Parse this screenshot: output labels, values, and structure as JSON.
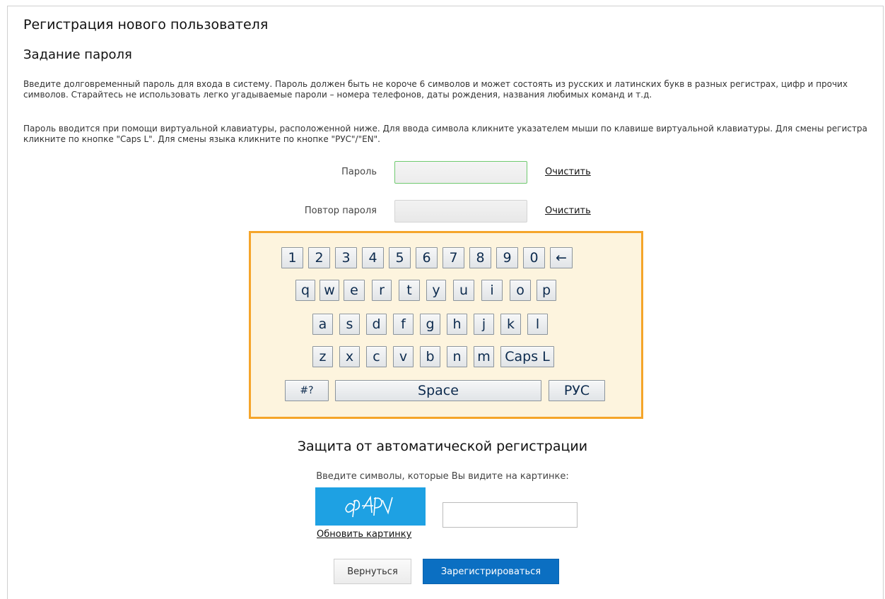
{
  "page": {
    "title": "Регистрация нового пользователя",
    "section_title": "Задание пароля",
    "paragraph1": "Введите долговременный пароль для входа в систему. Пароль должен быть не короче 6 символов и может состоять из русских и латинских букв в разных регистрах, цифр и прочих символов. Старайтесь не использовать легко угадываемые пароли – номера телефонов, даты рождения, названия любимых команд и т.д.",
    "paragraph2": "Пароль вводится при помощи виртуальной клавиатуры, расположенной ниже. Для ввода символа кликните указателем мыши по клавише виртуальной клавиатуры. Для смены регистра кликните по кнопке \"Caps L\". Для смены языка кликните по кнопке \"РУС\"/\"EN\"."
  },
  "password": {
    "label": "Пароль",
    "value": "",
    "clear_label": "Очистить"
  },
  "password_repeat": {
    "label": "Повтор пароля",
    "value": "",
    "clear_label": "Очистить"
  },
  "keyboard": {
    "row1": [
      "1",
      "2",
      "3",
      "4",
      "5",
      "6",
      "7",
      "8",
      "9",
      "0",
      "←"
    ],
    "row2": [
      "q",
      "w",
      "e",
      "r",
      "t",
      "y",
      "u",
      "i",
      "o",
      "p"
    ],
    "row3": [
      "a",
      "s",
      "d",
      "f",
      "g",
      "h",
      "j",
      "k",
      "l"
    ],
    "row4": [
      "z",
      "x",
      "c",
      "v",
      "b",
      "n",
      "m",
      "Caps L"
    ],
    "row5": [
      "#?",
      "Space",
      "РУС"
    ],
    "border_color": "#f5a52a",
    "background_color": "#fdf4de"
  },
  "captcha": {
    "title": "Защита от автоматической регистрации",
    "hint": "Введите символы, которые Вы видите на картинке:",
    "image_text": "ep4pv",
    "refresh_label": "Обновить картинку",
    "input_value": "",
    "image_color": "#1ea1e3"
  },
  "buttons": {
    "back_label": "Вернуться",
    "register_label": "Зарегистрироваться",
    "register_color": "#0b6fc2"
  }
}
